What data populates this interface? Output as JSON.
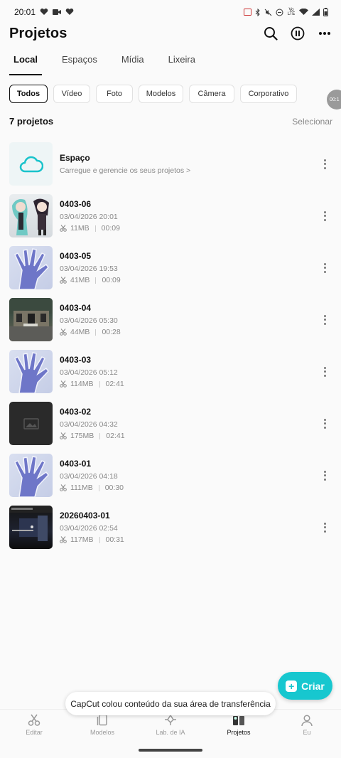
{
  "status_bar": {
    "time": "20:01",
    "net_label": "Vo LTE"
  },
  "header": {
    "title": "Projetos"
  },
  "tabs": [
    {
      "label": "Local"
    },
    {
      "label": "Espaços"
    },
    {
      "label": "Mídia"
    },
    {
      "label": "Lixeira"
    }
  ],
  "filters": [
    "Todos",
    "Vídeo",
    "Foto",
    "Modelos",
    "Câmera",
    "Corporativo"
  ],
  "float_bubble": {
    "text": "00:1"
  },
  "summary": {
    "count": "7 projetos",
    "select_label": "Selecionar"
  },
  "space": {
    "title": "Espaço",
    "subtitle": "Carregue e gerencie os seus projetos >"
  },
  "projects": [
    {
      "title": "0403-06",
      "date": "03/04/2026 20:01",
      "size": "11MB",
      "duration": "00:09"
    },
    {
      "title": "0403-05",
      "date": "03/04/2026 19:53",
      "size": "41MB",
      "duration": "00:09"
    },
    {
      "title": "0403-04",
      "date": "03/04/2026 05:30",
      "size": "44MB",
      "duration": "00:28"
    },
    {
      "title": "0403-03",
      "date": "03/04/2026 05:12",
      "size": "114MB",
      "duration": "02:41"
    },
    {
      "title": "0403-02",
      "date": "03/04/2026 04:32",
      "size": "175MB",
      "duration": "02:41"
    },
    {
      "title": "0403-01",
      "date": "03/04/2026 04:18",
      "size": "111MB",
      "duration": "00:30"
    },
    {
      "title": "20260403-01",
      "date": "03/04/2026 02:54",
      "size": "117MB",
      "duration": "00:31"
    }
  ],
  "fab": {
    "label": "Criar"
  },
  "toast": {
    "text": "CapCut colou conteúdo da sua área de transferência"
  },
  "bottom_nav": [
    {
      "label": "Editar",
      "icon": "scissors-icon"
    },
    {
      "label": "Modelos",
      "icon": "templates-icon"
    },
    {
      "label": "Lab. de IA",
      "icon": "ai-lab-icon"
    },
    {
      "label": "Projetos",
      "icon": "projects-icon"
    },
    {
      "label": "Eu",
      "icon": "profile-icon"
    }
  ],
  "colors": {
    "accent": "#17c7cf",
    "text": "#111111",
    "muted": "#888888"
  }
}
